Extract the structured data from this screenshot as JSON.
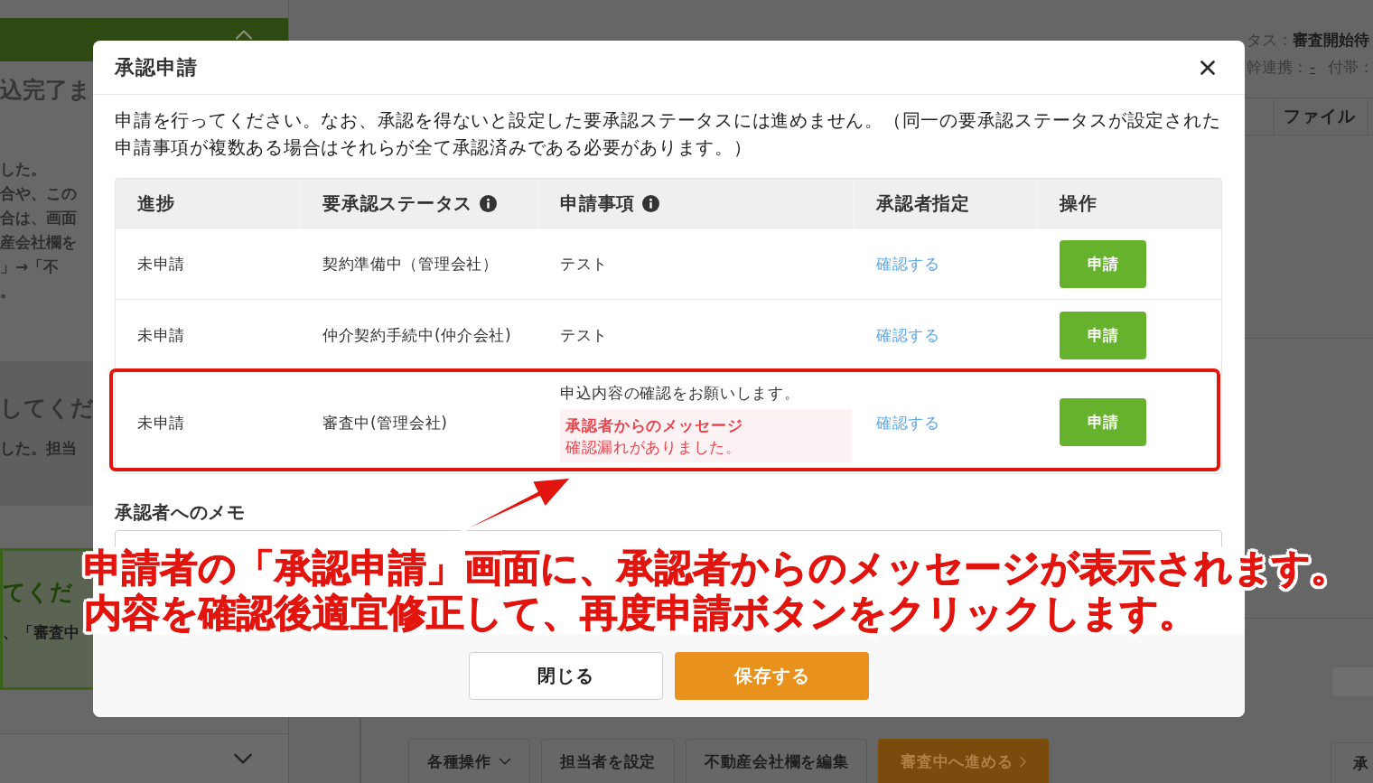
{
  "background": {
    "left_panel": {
      "top_bar": {
        "expanded": true
      },
      "notices": [
        {
          "kind": "plain",
          "title": "込完了ま",
          "lines": [
            "した。",
            "合や、この",
            "合は、画面",
            "産会社欄を",
            "」→「不",
            "。"
          ]
        },
        {
          "kind": "shaded",
          "title": "してくだ",
          "lines": [
            "した。担当"
          ]
        },
        {
          "kind": "success",
          "title": "てくだ",
          "lines": [
            "、「審査中"
          ]
        }
      ],
      "bottom_bar": {
        "expanded": false
      }
    },
    "right_column": {
      "status_label": "タス：",
      "status_value": "審査開始待",
      "link_label": "幹連携：",
      "link": "-",
      "extra_label": "付帯：",
      "table_header": "ファイル"
    },
    "toolbar": {
      "buttons": [
        {
          "kind": "menu",
          "label": "各種操作"
        },
        {
          "kind": "plain",
          "label": "担当者を設定"
        },
        {
          "kind": "plain",
          "label": "不動産会社欄を編集"
        },
        {
          "kind": "primary",
          "label": "審査中へ進める"
        }
      ],
      "side_button": "承"
    }
  },
  "dialog": {
    "title": "承認申請",
    "description": "申請を行ってください。なお、承認を得ないと設定した要承認ステータスには進めません。（同一の要承認ステータスが設定された申請事項が複数ある場合はそれらが全て承認済みである必要があります。）",
    "table": {
      "columns": [
        {
          "label": "進捗",
          "info": false
        },
        {
          "label": "要承認ステータス",
          "info": true
        },
        {
          "label": "申請事項",
          "info": true
        },
        {
          "label": "承認者指定",
          "info": false
        },
        {
          "label": "操作",
          "info": false
        }
      ],
      "rows": [
        {
          "progress": "未申請",
          "status": "契約準備中（管理会社）",
          "item": "テスト",
          "approver": "確認する",
          "action": "申請",
          "highlighted": false
        },
        {
          "progress": "未申請",
          "status": "仲介契約手続中(仲介会社)",
          "item": "テスト",
          "approver": "確認する",
          "action": "申請",
          "highlighted": false
        },
        {
          "progress": "未申請",
          "status": "審査中(管理会社)",
          "item": "申込内容の確認をお願いします。",
          "message": {
            "title": "承認者からのメッセージ",
            "text": "確認漏れがありました。"
          },
          "approver": "確認する",
          "action": "申請",
          "highlighted": true
        }
      ]
    },
    "memo": {
      "label": "承認者へのメモ"
    },
    "buttons": [
      {
        "kind": "secondary",
        "label": "閉じる"
      },
      {
        "kind": "primary",
        "label": "保存する"
      }
    ]
  },
  "annotation": {
    "lines": [
      "申請者の「承認申請」画面に、承認者からのメッセージが表示されます。",
      "内容を確認後適宜修正して、再度申請ボタンをクリックします。"
    ]
  }
}
